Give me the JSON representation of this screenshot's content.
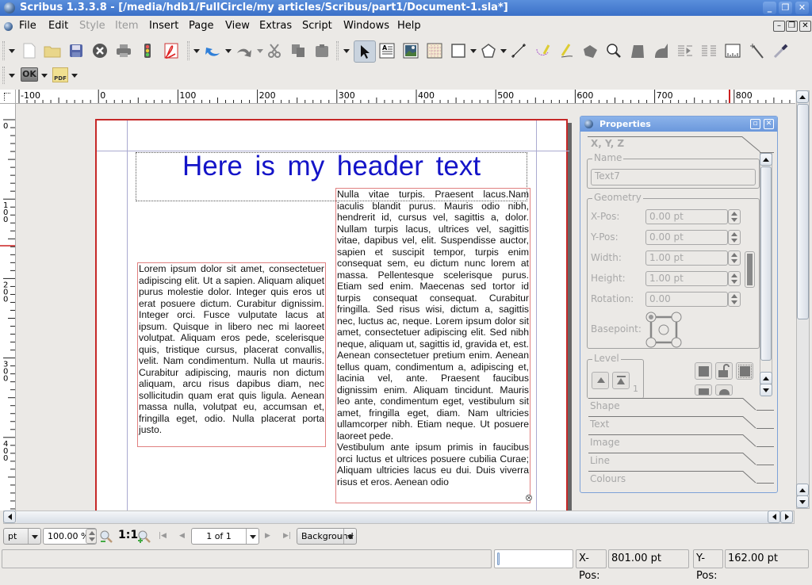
{
  "window": {
    "title": "Scribus 1.3.3.8 - [/media/hdb1/FullCircle/my articles/Scribus/part1/Document-1.sla*]",
    "controls": {
      "minimize": "_",
      "restore": "❐",
      "close": "✕"
    }
  },
  "menubar": {
    "items": [
      {
        "label": "File",
        "enabled": true
      },
      {
        "label": "Edit",
        "enabled": true
      },
      {
        "label": "Style",
        "enabled": false
      },
      {
        "label": "Item",
        "enabled": false
      },
      {
        "label": "Insert",
        "enabled": true
      },
      {
        "label": "Page",
        "enabled": true
      },
      {
        "label": "View",
        "enabled": true
      },
      {
        "label": "Extras",
        "enabled": true
      },
      {
        "label": "Script",
        "enabled": true
      },
      {
        "label": "Windows",
        "enabled": true
      },
      {
        "label": "Help",
        "enabled": true
      }
    ],
    "mdi_controls": {
      "minimize": "–",
      "restore": "❐",
      "close": "✕"
    }
  },
  "toolbar": {
    "tools": [
      "new-document",
      "open",
      "save",
      "close",
      "print",
      "preflight-verifier",
      "export-pdf",
      "undo",
      "redo",
      "cut",
      "copy",
      "paste",
      "select-item",
      "insert-text-frame",
      "insert-image-frame",
      "insert-table",
      "insert-shape",
      "insert-polygon",
      "insert-line",
      "insert-bezier",
      "insert-freehand-line",
      "rotate-item",
      "zoom",
      "edit-contents",
      "edit-text",
      "link-text-frames",
      "unlink-text-frames",
      "measurements",
      "copy-item-properties",
      "eye-dropper"
    ],
    "ok_label": "OK",
    "pdf_label": "PDF"
  },
  "rulers": {
    "horizontal_ticks": [
      "-100",
      "0",
      "100",
      "200",
      "300",
      "400",
      "500",
      "600",
      "700",
      "800"
    ],
    "vertical_ticks": [
      "0",
      "100",
      "200",
      "300",
      "400"
    ]
  },
  "document": {
    "header_text": "Here is my header text",
    "left_frame_text": "Lorem ipsum dolor sit amet, consectetuer adipiscing elit. Ut a sapien. Aliquam aliquet purus molestie dolor. Integer quis eros ut erat posuere dictum. Curabitur dignissim. Integer orci. Fusce vulputate lacus at ipsum. Quisque in libero nec mi laoreet volutpat. Aliquam eros pede, scelerisque quis, tristique cursus, placerat convallis, velit. Nam condimentum. Nulla ut mauris. Curabitur adipiscing, mauris non dictum aliquam, arcu risus dapibus diam, nec sollicitudin quam erat quis ligula. Aenean massa nulla, volutpat eu, accumsan et, fringilla eget, odio. Nulla placerat porta justo.",
    "right_frame_text": "Nulla vitae turpis. Praesent lacus.Nam iaculis blandit purus. Mauris odio nibh, hendrerit id, cursus vel, sagittis a, dolor. Nullam turpis lacus, ultrices vel, sagittis vitae, dapibus vel, elit. Suspendisse auctor, sapien et suscipit tempor, turpis enim consequat sem, eu dictum nunc lorem at massa. Pellentesque scelerisque purus. Etiam sed enim. Maecenas sed tortor id turpis consequat consequat. Curabitur fringilla. Sed risus wisi, dictum a, sagittis nec, luctus ac, neque. Lorem ipsum dolor sit amet, consectetuer adipiscing elit. Sed nibh neque, aliquam ut, sagittis id, gravida et, est. Aenean consectetuer pretium enim. Aenean tellus quam, condimentum a, adipiscing et, lacinia vel, ante. Praesent faucibus dignissim enim. Aliquam tincidunt. Mauris leo ante, condimentum eget, vestibulum sit amet, fringilla eget, diam. Nam ultricies ullamcorper nibh. Etiam neque. Ut posuere laoreet pede.",
    "right_frame_text_2": "Vestibulum ante ipsum primis in faucibus orci luctus et ultrices posuere cubilia Curae; Aliquam ultricies lacus eu dui. Duis viverra risus et eros. Aenean odio",
    "colors": {
      "header": "#1414c8",
      "page_border": "#c62828",
      "frame_border": "#e08080",
      "guide": "#aaaad0"
    }
  },
  "properties": {
    "title": "Properties",
    "section_xyz": "X, Y, Z",
    "name_group": "Name",
    "name_value": "Text7",
    "geometry_group": "Geometry",
    "fields": [
      {
        "label": "X-Pos:",
        "value": "0.00 pt"
      },
      {
        "label": "Y-Pos:",
        "value": "0.00 pt"
      },
      {
        "label": "Width:",
        "value": "1.00 pt"
      },
      {
        "label": "Height:",
        "value": "1.00 pt"
      },
      {
        "label": "Rotation:",
        "value": "0.00"
      }
    ],
    "basepoint_label": "Basepoint:",
    "level_group": "Level",
    "level_value": "1",
    "sections": [
      "Shape",
      "Text",
      "Image",
      "Line",
      "Colours"
    ]
  },
  "bottombar": {
    "unit": "pt",
    "zoom": "100.00 %",
    "zoom_one_to_one": "1:1",
    "page": "1 of 1",
    "layer": "Background"
  },
  "statusbar": {
    "message": "",
    "xpos_label": "X-Pos:",
    "xpos_value": "801.00 pt",
    "ypos_label": "Y-Pos:",
    "ypos_value": "162.00 pt"
  }
}
